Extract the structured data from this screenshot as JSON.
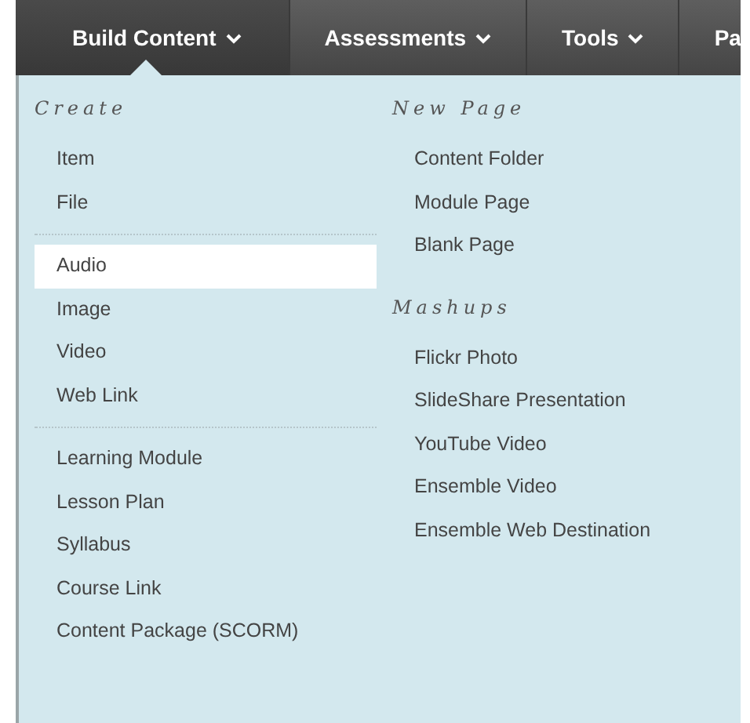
{
  "tabs": [
    {
      "label": "Build Content",
      "kind": "dropdown",
      "selected": true
    },
    {
      "label": "Assessments",
      "kind": "dropdown",
      "selected": false
    },
    {
      "label": "Tools",
      "kind": "dropdown",
      "selected": false
    },
    {
      "label": "Pa",
      "kind": "plain",
      "selected": false
    }
  ],
  "menu": {
    "columns": [
      {
        "sections": [
          {
            "heading": "Create",
            "groups": [
              [
                {
                  "label": "Item",
                  "selected": false
                },
                {
                  "label": "File",
                  "selected": false
                }
              ],
              [
                {
                  "label": "Audio",
                  "selected": true
                },
                {
                  "label": "Image",
                  "selected": false
                },
                {
                  "label": "Video",
                  "selected": false
                },
                {
                  "label": "Web Link",
                  "selected": false
                }
              ],
              [
                {
                  "label": "Learning Module",
                  "selected": false
                },
                {
                  "label": "Lesson Plan",
                  "selected": false
                },
                {
                  "label": "Syllabus",
                  "selected": false
                },
                {
                  "label": "Course Link",
                  "selected": false
                },
                {
                  "label": "Content Package (SCORM)",
                  "selected": false
                }
              ]
            ]
          }
        ]
      },
      {
        "sections": [
          {
            "heading": "New Page",
            "groups": [
              [
                {
                  "label": "Content Folder",
                  "selected": false
                },
                {
                  "label": "Module Page",
                  "selected": false
                },
                {
                  "label": "Blank Page",
                  "selected": false
                }
              ]
            ]
          },
          {
            "heading": "Mashups",
            "groups": [
              [
                {
                  "label": "Flickr Photo",
                  "selected": false
                },
                {
                  "label": "SlideShare Presentation",
                  "selected": false
                },
                {
                  "label": "YouTube Video",
                  "selected": false
                },
                {
                  "label": "Ensemble Video",
                  "selected": false
                },
                {
                  "label": "Ensemble Web Destination",
                  "selected": false
                }
              ]
            ]
          }
        ]
      }
    ]
  }
}
